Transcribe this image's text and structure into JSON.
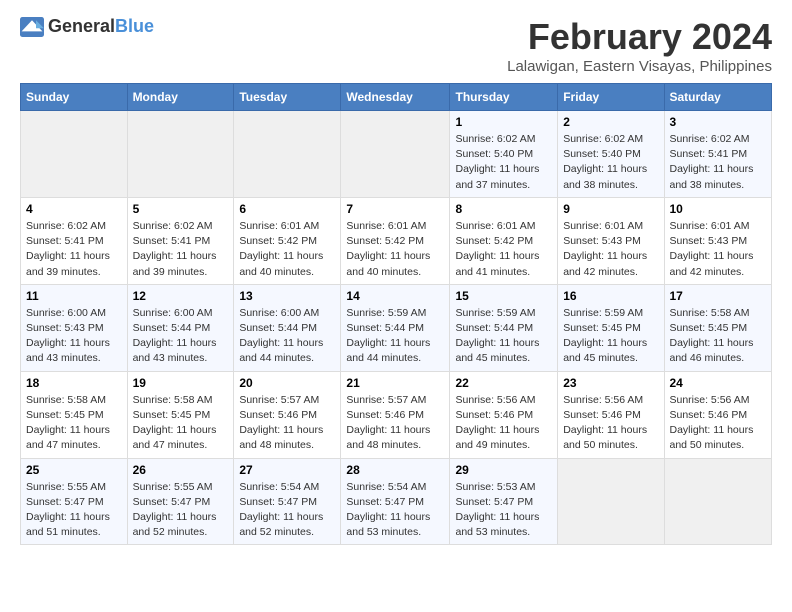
{
  "logo": {
    "general": "General",
    "blue": "Blue"
  },
  "title": "February 2024",
  "subtitle": "Lalawigan, Eastern Visayas, Philippines",
  "headers": [
    "Sunday",
    "Monday",
    "Tuesday",
    "Wednesday",
    "Thursday",
    "Friday",
    "Saturday"
  ],
  "weeks": [
    [
      {
        "day": "",
        "info": ""
      },
      {
        "day": "",
        "info": ""
      },
      {
        "day": "",
        "info": ""
      },
      {
        "day": "",
        "info": ""
      },
      {
        "day": "1",
        "info": "Sunrise: 6:02 AM\nSunset: 5:40 PM\nDaylight: 11 hours and 37 minutes."
      },
      {
        "day": "2",
        "info": "Sunrise: 6:02 AM\nSunset: 5:40 PM\nDaylight: 11 hours and 38 minutes."
      },
      {
        "day": "3",
        "info": "Sunrise: 6:02 AM\nSunset: 5:41 PM\nDaylight: 11 hours and 38 minutes."
      }
    ],
    [
      {
        "day": "4",
        "info": "Sunrise: 6:02 AM\nSunset: 5:41 PM\nDaylight: 11 hours and 39 minutes."
      },
      {
        "day": "5",
        "info": "Sunrise: 6:02 AM\nSunset: 5:41 PM\nDaylight: 11 hours and 39 minutes."
      },
      {
        "day": "6",
        "info": "Sunrise: 6:01 AM\nSunset: 5:42 PM\nDaylight: 11 hours and 40 minutes."
      },
      {
        "day": "7",
        "info": "Sunrise: 6:01 AM\nSunset: 5:42 PM\nDaylight: 11 hours and 40 minutes."
      },
      {
        "day": "8",
        "info": "Sunrise: 6:01 AM\nSunset: 5:42 PM\nDaylight: 11 hours and 41 minutes."
      },
      {
        "day": "9",
        "info": "Sunrise: 6:01 AM\nSunset: 5:43 PM\nDaylight: 11 hours and 42 minutes."
      },
      {
        "day": "10",
        "info": "Sunrise: 6:01 AM\nSunset: 5:43 PM\nDaylight: 11 hours and 42 minutes."
      }
    ],
    [
      {
        "day": "11",
        "info": "Sunrise: 6:00 AM\nSunset: 5:43 PM\nDaylight: 11 hours and 43 minutes."
      },
      {
        "day": "12",
        "info": "Sunrise: 6:00 AM\nSunset: 5:44 PM\nDaylight: 11 hours and 43 minutes."
      },
      {
        "day": "13",
        "info": "Sunrise: 6:00 AM\nSunset: 5:44 PM\nDaylight: 11 hours and 44 minutes."
      },
      {
        "day": "14",
        "info": "Sunrise: 5:59 AM\nSunset: 5:44 PM\nDaylight: 11 hours and 44 minutes."
      },
      {
        "day": "15",
        "info": "Sunrise: 5:59 AM\nSunset: 5:44 PM\nDaylight: 11 hours and 45 minutes."
      },
      {
        "day": "16",
        "info": "Sunrise: 5:59 AM\nSunset: 5:45 PM\nDaylight: 11 hours and 45 minutes."
      },
      {
        "day": "17",
        "info": "Sunrise: 5:58 AM\nSunset: 5:45 PM\nDaylight: 11 hours and 46 minutes."
      }
    ],
    [
      {
        "day": "18",
        "info": "Sunrise: 5:58 AM\nSunset: 5:45 PM\nDaylight: 11 hours and 47 minutes."
      },
      {
        "day": "19",
        "info": "Sunrise: 5:58 AM\nSunset: 5:45 PM\nDaylight: 11 hours and 47 minutes."
      },
      {
        "day": "20",
        "info": "Sunrise: 5:57 AM\nSunset: 5:46 PM\nDaylight: 11 hours and 48 minutes."
      },
      {
        "day": "21",
        "info": "Sunrise: 5:57 AM\nSunset: 5:46 PM\nDaylight: 11 hours and 48 minutes."
      },
      {
        "day": "22",
        "info": "Sunrise: 5:56 AM\nSunset: 5:46 PM\nDaylight: 11 hours and 49 minutes."
      },
      {
        "day": "23",
        "info": "Sunrise: 5:56 AM\nSunset: 5:46 PM\nDaylight: 11 hours and 50 minutes."
      },
      {
        "day": "24",
        "info": "Sunrise: 5:56 AM\nSunset: 5:46 PM\nDaylight: 11 hours and 50 minutes."
      }
    ],
    [
      {
        "day": "25",
        "info": "Sunrise: 5:55 AM\nSunset: 5:47 PM\nDaylight: 11 hours and 51 minutes."
      },
      {
        "day": "26",
        "info": "Sunrise: 5:55 AM\nSunset: 5:47 PM\nDaylight: 11 hours and 52 minutes."
      },
      {
        "day": "27",
        "info": "Sunrise: 5:54 AM\nSunset: 5:47 PM\nDaylight: 11 hours and 52 minutes."
      },
      {
        "day": "28",
        "info": "Sunrise: 5:54 AM\nSunset: 5:47 PM\nDaylight: 11 hours and 53 minutes."
      },
      {
        "day": "29",
        "info": "Sunrise: 5:53 AM\nSunset: 5:47 PM\nDaylight: 11 hours and 53 minutes."
      },
      {
        "day": "",
        "info": ""
      },
      {
        "day": "",
        "info": ""
      }
    ]
  ]
}
